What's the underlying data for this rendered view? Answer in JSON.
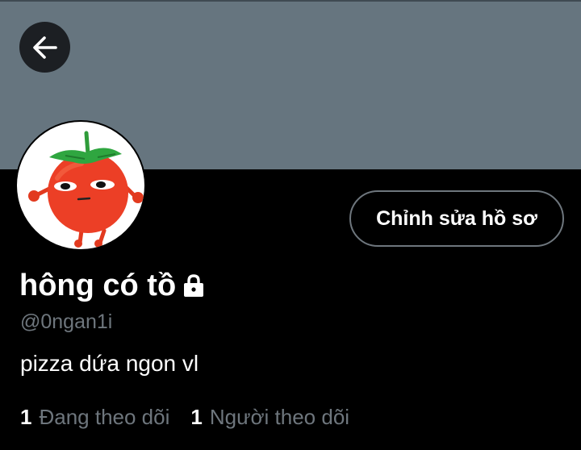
{
  "profile": {
    "display_name": "hông có tồ",
    "handle": "@0ngan1i",
    "bio": "pizza dứa ngon vl",
    "is_protected": true
  },
  "actions": {
    "edit_profile_label": "Chỉnh sửa hồ sơ"
  },
  "stats": {
    "following_count": "1",
    "following_label": "Đang theo dõi",
    "followers_count": "1",
    "followers_label": "Người theo dõi"
  },
  "icons": {
    "back": "arrow-left-icon",
    "lock": "lock-icon"
  },
  "colors": {
    "banner": "#66757f",
    "background": "#000000",
    "muted_text": "#6e767d",
    "button_border": "#6e767d"
  }
}
